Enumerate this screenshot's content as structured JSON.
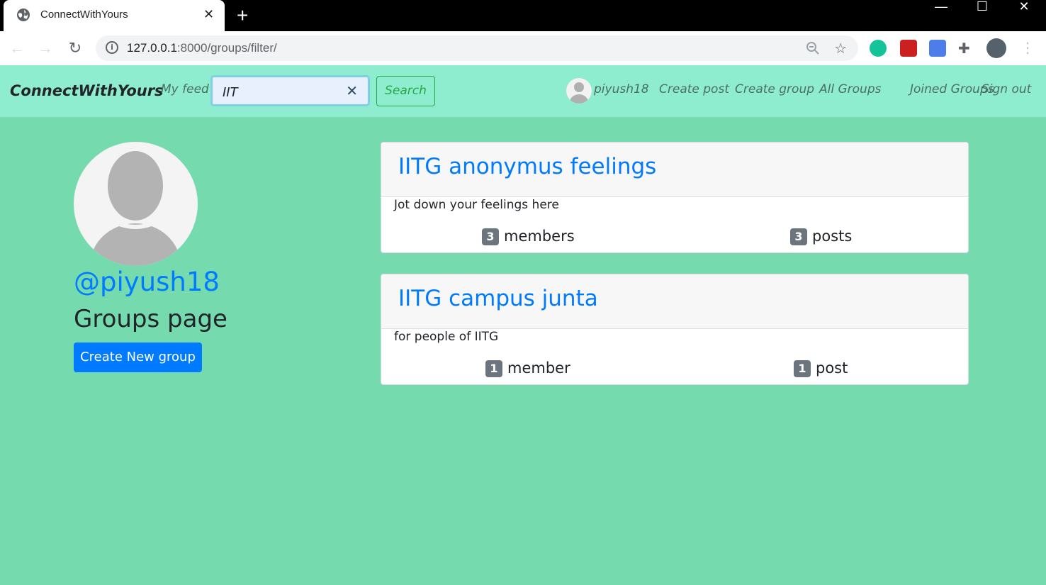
{
  "browser": {
    "tab_title": "ConnectWithYours",
    "tab_close": "✕",
    "new_tab": "+",
    "url_host": "127.0.0.1",
    "url_path": ":8000/groups/filter/",
    "window_controls": {
      "minimize": "—",
      "maximize": "☐",
      "close": "✕"
    }
  },
  "navbar": {
    "brand": "ConnectWithYours",
    "my_feed": "My feed",
    "search": {
      "value": "IIT",
      "clear": "✕"
    },
    "search_button": "Search",
    "username": "piyush18",
    "links": [
      "Create post",
      "Create group",
      "All Groups",
      "Joined Groups",
      "Sign out"
    ]
  },
  "profile": {
    "handle": "@piyush18",
    "page_title": "Groups page",
    "create_button": "Create New group"
  },
  "groups": [
    {
      "name": "IITG anonymus feelings",
      "description": "Jot down your feelings here",
      "members_count": "3",
      "members_label": "members",
      "posts_count": "3",
      "posts_label": "posts"
    },
    {
      "name": "IITG campus junta",
      "description": "for people of IITG",
      "members_count": "1",
      "members_label": "member",
      "posts_count": "1",
      "posts_label": "post"
    }
  ],
  "colors": {
    "page_bg": "#75dbaf",
    "navbar_bg": "#8eeccf",
    "primary": "#007bff",
    "success": "#28a745",
    "badge": "#6c757d"
  }
}
